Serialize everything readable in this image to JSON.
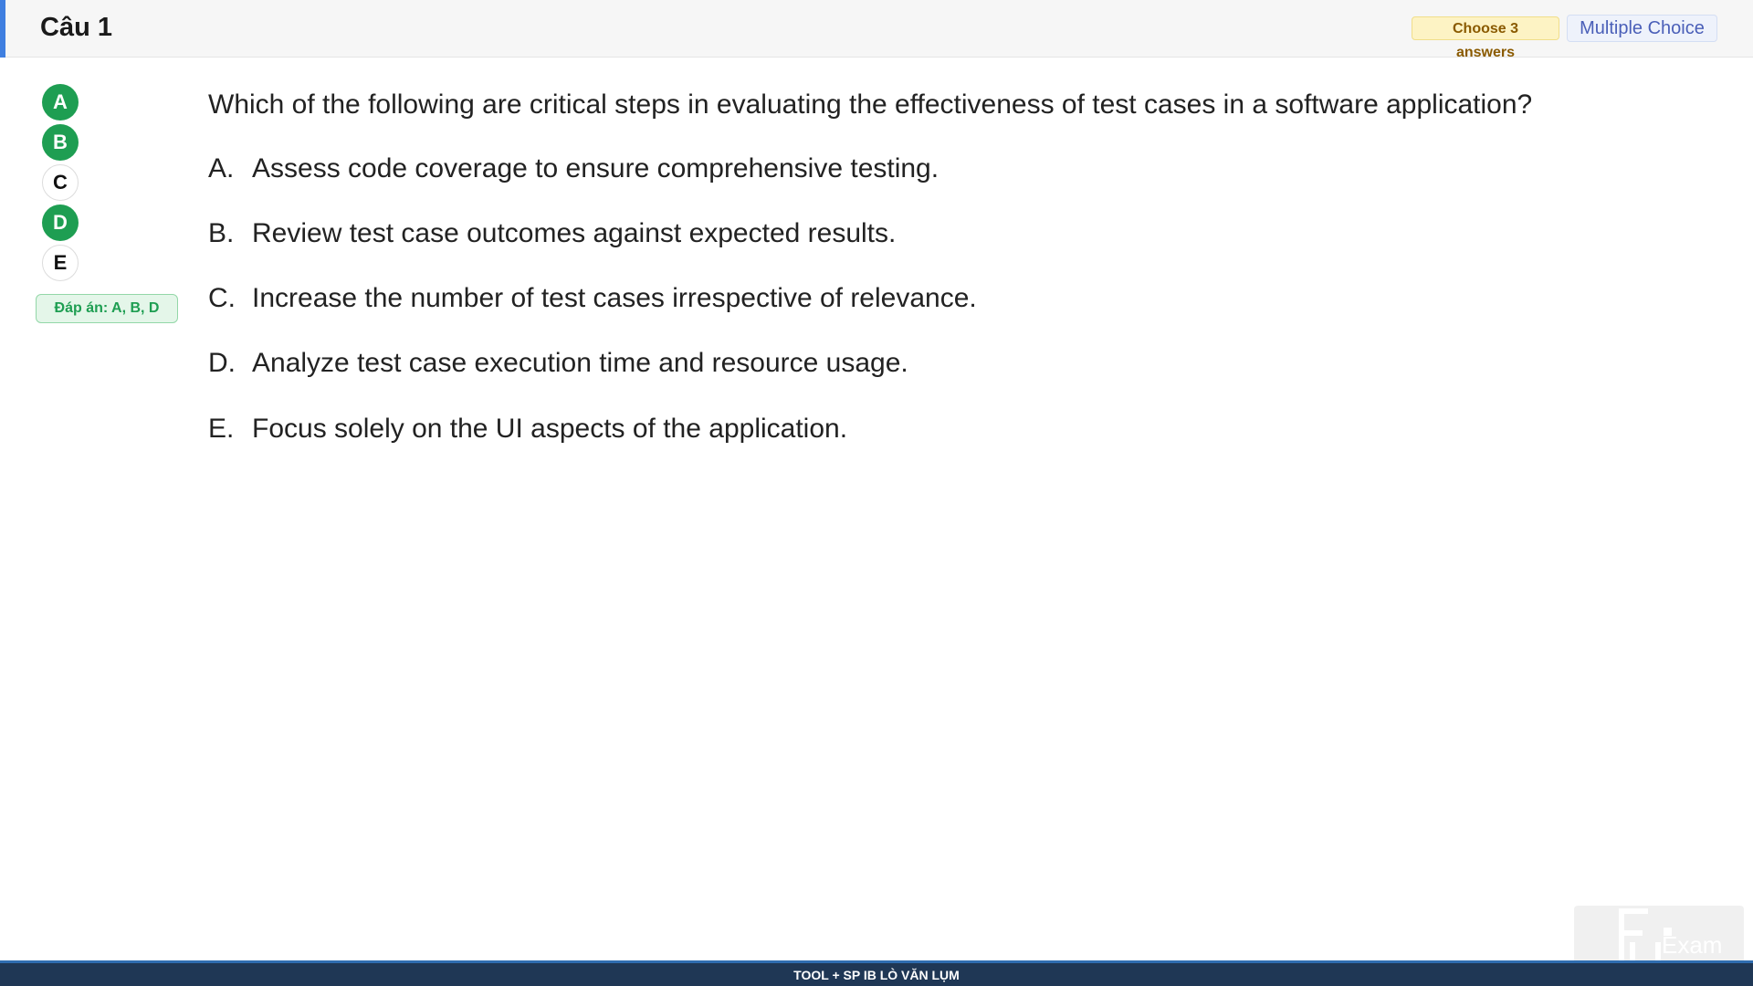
{
  "header": {
    "title": "Câu 1",
    "choose_badge": "Choose 3 answers",
    "type_badge": "Multiple Choice",
    "accent_color": "#3f7fe0"
  },
  "answers_panel": {
    "options": [
      {
        "letter": "A",
        "selected": true
      },
      {
        "letter": "B",
        "selected": true
      },
      {
        "letter": "C",
        "selected": false
      },
      {
        "letter": "D",
        "selected": true
      },
      {
        "letter": "E",
        "selected": false
      }
    ],
    "answer_label": "Đáp án: A, B, D",
    "correct_color": "#1e9e52"
  },
  "question": {
    "text": "Which of the following are critical steps in evaluating the effectiveness of test cases in a software application?",
    "options": [
      {
        "letter": "A.",
        "text": "Assess code coverage to ensure comprehensive testing."
      },
      {
        "letter": "B.",
        "text": "Review test case outcomes against expected results."
      },
      {
        "letter": "C.",
        "text": "Increase the number of test cases irrespective of relevance."
      },
      {
        "letter": "D.",
        "text": "Analyze test case execution time and resource usage."
      },
      {
        "letter": "E.",
        "text": "Focus solely on the UI aspects of the application."
      }
    ]
  },
  "watermark": {
    "text": "Exam",
    "icon": "fu-logo-icon"
  },
  "footer": {
    "text": "TOOL + SP IB LÒ VĂN LỤM"
  }
}
